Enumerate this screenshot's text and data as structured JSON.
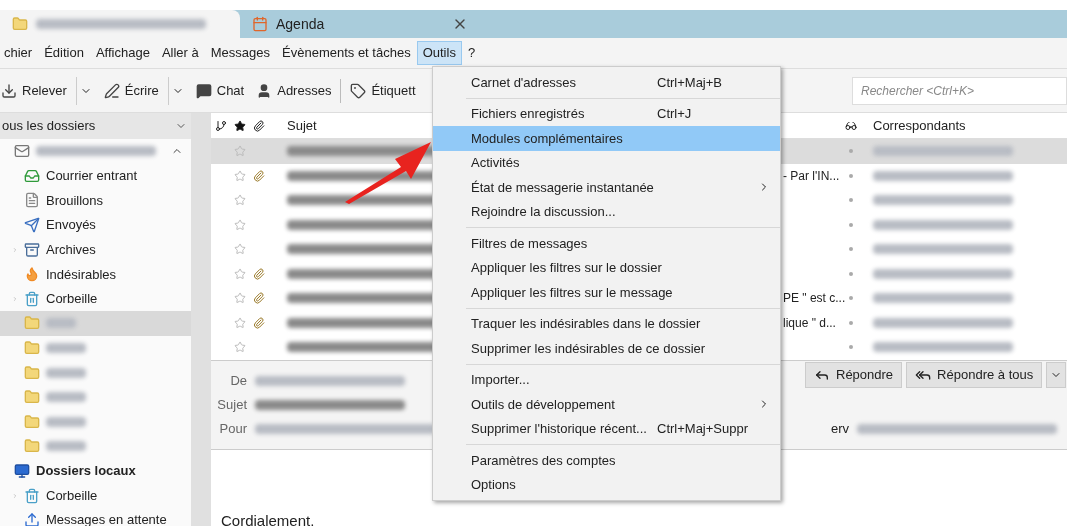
{
  "tabs": [
    {
      "selected": true
    },
    {
      "label": "Agenda",
      "selected": false
    }
  ],
  "menubar": [
    {
      "label": "chier",
      "selected": false
    },
    {
      "label": "Édition",
      "selected": false
    },
    {
      "label": "Affichage",
      "selected": false
    },
    {
      "label": "Aller à",
      "selected": false
    },
    {
      "label": "Messages",
      "selected": false
    },
    {
      "label": "Évènements et tâches",
      "selected": false
    },
    {
      "label": "Outils",
      "selected": true
    },
    {
      "label": "?",
      "selected": false
    }
  ],
  "toolbar": [
    {
      "kind": "fetch",
      "label": "Relever"
    },
    {
      "kind": "dropdown"
    },
    {
      "kind": "compose",
      "label": "Écrire"
    },
    {
      "kind": "dropdown"
    },
    {
      "kind": "chat",
      "label": "Chat"
    },
    {
      "kind": "contacts",
      "label": "Adresses"
    },
    {
      "kind": "separator"
    },
    {
      "kind": "tags",
      "label": "Étiquett"
    }
  ],
  "search": {
    "placeholder": "Rechercher <Ctrl+K>"
  },
  "folder_pane": {
    "title": "ous les dossiers",
    "tree": [
      {
        "kind": "account",
        "selected": false,
        "expanded": true,
        "children": [
          {
            "label": "Courrier entrant",
            "kind": "inbox",
            "selected": false
          },
          {
            "label": "Brouillons",
            "kind": "drafts",
            "selected": false
          },
          {
            "label": "Envoyés",
            "kind": "sent",
            "selected": false
          },
          {
            "label": "Archives",
            "kind": "archive",
            "selected": false,
            "expanded": false
          },
          {
            "label": "Indésirables",
            "kind": "junk",
            "selected": false
          },
          {
            "label": "Corbeille",
            "kind": "trash",
            "selected": false,
            "expanded": false
          },
          {
            "kind": "folder",
            "selected": true
          },
          {
            "kind": "folder",
            "selected": false
          },
          {
            "kind": "folder",
            "selected": false
          },
          {
            "kind": "folder",
            "selected": false
          },
          {
            "kind": "folder",
            "selected": false
          },
          {
            "kind": "folder",
            "selected": false
          }
        ]
      },
      {
        "label": "Dossiers locaux",
        "kind": "local",
        "selected": false,
        "children": [
          {
            "label": "Corbeille",
            "kind": "trash",
            "selected": false,
            "expanded": false
          },
          {
            "label": "Messages en attente",
            "kind": "outbox",
            "selected": false
          }
        ]
      }
    ]
  },
  "message_list": {
    "columns": {
      "subject": "Sujet",
      "correspondents": "Correspondants"
    },
    "rows": [
      {
        "selected": true,
        "attachment": false
      },
      {
        "selected": false,
        "attachment": true,
        "subject_tail": "- Par l'IN..."
      },
      {
        "selected": false,
        "attachment": false
      },
      {
        "selected": false,
        "attachment": false
      },
      {
        "selected": false,
        "attachment": false
      },
      {
        "selected": false,
        "attachment": true
      },
      {
        "selected": false,
        "attachment": true,
        "subject_tail": "PE \" est c..."
      },
      {
        "selected": false,
        "attachment": true,
        "subject_tail": "lique \" d..."
      },
      {
        "selected": false,
        "attachment": false
      }
    ]
  },
  "message_header": {
    "fields": [
      {
        "label": "De"
      },
      {
        "label": "Sujet"
      },
      {
        "label": "Pour",
        "tail": "erv"
      }
    ],
    "buttons": [
      {
        "kind": "reply",
        "label": "Répondre"
      },
      {
        "kind": "reply_all",
        "label": "Répondre à tous"
      }
    ]
  },
  "message_body": "Cordialement.",
  "tools_menu": [
    {
      "kind": "item",
      "label": "Carnet d'adresses",
      "shortcut": "Ctrl+Maj+B",
      "submenu": false,
      "selected": false
    },
    {
      "kind": "separator"
    },
    {
      "kind": "item",
      "label": "Fichiers enregistrés",
      "shortcut": "Ctrl+J",
      "submenu": false,
      "selected": false
    },
    {
      "kind": "item",
      "label": "Modules complémentaires",
      "submenu": false,
      "selected": true
    },
    {
      "kind": "item",
      "label": "Activités",
      "submenu": false,
      "selected": false
    },
    {
      "kind": "item",
      "label": "État de messagerie instantanée",
      "submenu": true,
      "selected": false
    },
    {
      "kind": "item",
      "label": "Rejoindre la discussion...",
      "submenu": false,
      "selected": false
    },
    {
      "kind": "separator"
    },
    {
      "kind": "item",
      "label": "Filtres de messages",
      "submenu": false,
      "selected": false
    },
    {
      "kind": "item",
      "label": "Appliquer les filtres sur le dossier",
      "submenu": false,
      "selected": false
    },
    {
      "kind": "item",
      "label": "Appliquer les filtres sur le message",
      "submenu": false,
      "selected": false
    },
    {
      "kind": "separator"
    },
    {
      "kind": "item",
      "label": "Traquer les indésirables dans le dossier",
      "submenu": false,
      "selected": false
    },
    {
      "kind": "item",
      "label": "Supprimer les indésirables de ce dossier",
      "submenu": false,
      "selected": false
    },
    {
      "kind": "separator"
    },
    {
      "kind": "item",
      "label": "Importer...",
      "submenu": false,
      "selected": false
    },
    {
      "kind": "item",
      "label": "Outils de développement",
      "submenu": true,
      "selected": false
    },
    {
      "kind": "item",
      "label": "Supprimer l'historique récent...",
      "shortcut": "Ctrl+Maj+Suppr",
      "submenu": false,
      "selected": false
    },
    {
      "kind": "separator"
    },
    {
      "kind": "item",
      "label": "Paramètres des comptes",
      "submenu": false,
      "selected": false
    },
    {
      "kind": "item",
      "label": "Options",
      "submenu": false,
      "selected": false
    }
  ]
}
